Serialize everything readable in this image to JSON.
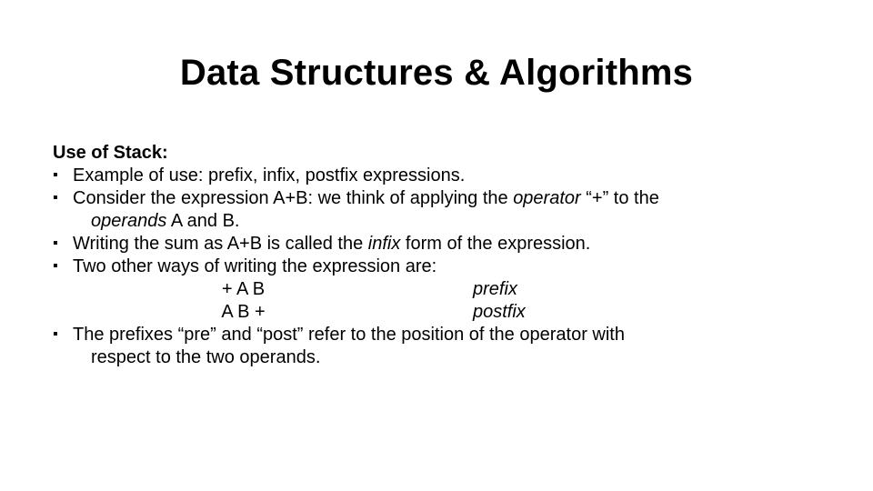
{
  "title": "Data Structures & Algorithms",
  "heading": "Use of Stack:",
  "b1": "Example of use: prefix, infix, postfix expressions.",
  "b2a": "Consider the expression A+B: we think of applying the ",
  "b2_op": "operator",
  "b2b": " “+” to the",
  "b2c": "operands",
  "b2d": " A and B.",
  "b3a": "Writing the sum as A+B is called the ",
  "b3_infix": "infix",
  "b3b": " form of the expression.",
  "b4": "Two other ways of writing the expression are:",
  "r1c1": "+ A B",
  "r1c2": "prefix",
  "r2c1": "A B +",
  "r2c2": "postfix",
  "b5a": "The prefixes “pre” and “post” refer to the position of the operator with",
  "b5b": "respect to the two operands."
}
